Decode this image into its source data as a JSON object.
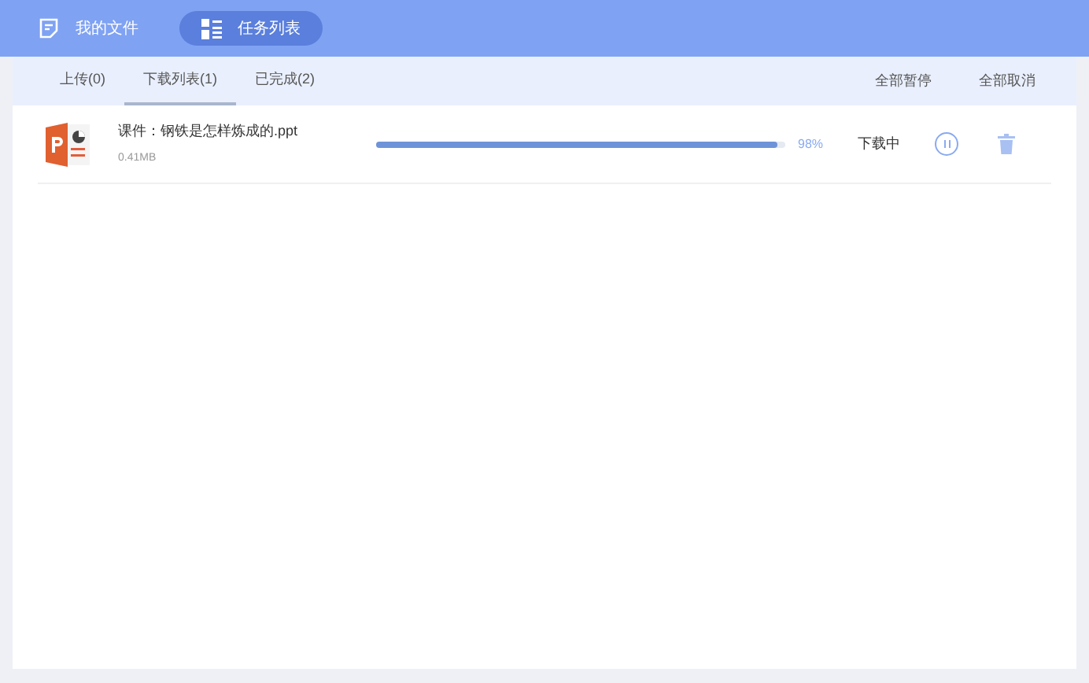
{
  "nav": [
    {
      "label": "我的文件",
      "kind": "file",
      "selected": false
    },
    {
      "label": "任务列表",
      "kind": "list",
      "selected": true
    }
  ],
  "tabs": [
    {
      "label": "上传(0)",
      "selected": false
    },
    {
      "label": "下载列表(1)",
      "selected": true
    },
    {
      "label": "已完成(2)",
      "selected": false
    }
  ],
  "actions": [
    "全部暂停",
    "全部取消"
  ],
  "tasks": [
    {
      "name": "课件：钢铁是怎样炼成的.ppt",
      "size": "0.41MB",
      "level": 0.98,
      "percent": "98%",
      "status": "下载中"
    }
  ]
}
